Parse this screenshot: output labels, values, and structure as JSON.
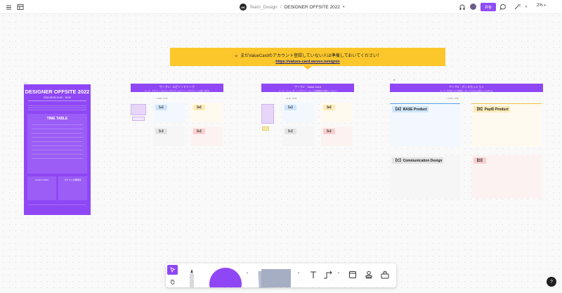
{
  "header": {
    "team": "Team_Design",
    "separator": "/",
    "board_title": "DESIGNER OFFSITE 2022",
    "share_label": "共有",
    "zoom": "2%"
  },
  "banner": {
    "message": "🐱 まだValueCardのアカウント登録していない人は準備しておいてください！",
    "link": "https://values-card.wevox.io/signin"
  },
  "poster": {
    "title": "DESIGNER OFFSITE 2022",
    "date": "2022.08.26 10:00 - 18:30",
    "timetable_title": "TIME TABLE",
    "box_left": "Leanin' Coffee",
    "box_right": "ネクストの課題感"
  },
  "sections": [
    {
      "title": "ワーク1：エピソードトーク",
      "subtitle": "テーマ：デザイナーとなるきっかけとなったエピソードやデザインへの想いを共有"
    },
    {
      "title": "ワーク2：Value Card",
      "subtitle": "テーマ：バリューカードでデザイナーとしての価値観を可視化してみよう"
    },
    {
      "title": "ワーク3：ディスカッション",
      "subtitle": "テーマ：Designでより組織を一丸にするために必要なことを考える"
    }
  ],
  "group_tags": {
    "a": "【A】",
    "b": "【B】",
    "c": "【C】",
    "d": "【D】"
  },
  "work3_cards": {
    "a": "【A】BASE Product",
    "b": "【B】PayID Product",
    "c": "【C】Communication Design",
    "d": "【D】"
  },
  "colors": {
    "accent": "#8f47f5",
    "banner": "#fcc72b",
    "tag_blue": "#cfe5fb",
    "tag_yellow": "#fdeab8",
    "tag_gray": "#e3e3e3",
    "tag_red": "#f8cfcf"
  },
  "toolbar_icons": [
    "cursor-icon",
    "hand-icon",
    "pen-icon",
    "shape-icon",
    "sticky-note-icon",
    "text-icon",
    "connector-icon",
    "frame-icon",
    "stamp-icon",
    "comment-icon"
  ],
  "help_label": "?"
}
